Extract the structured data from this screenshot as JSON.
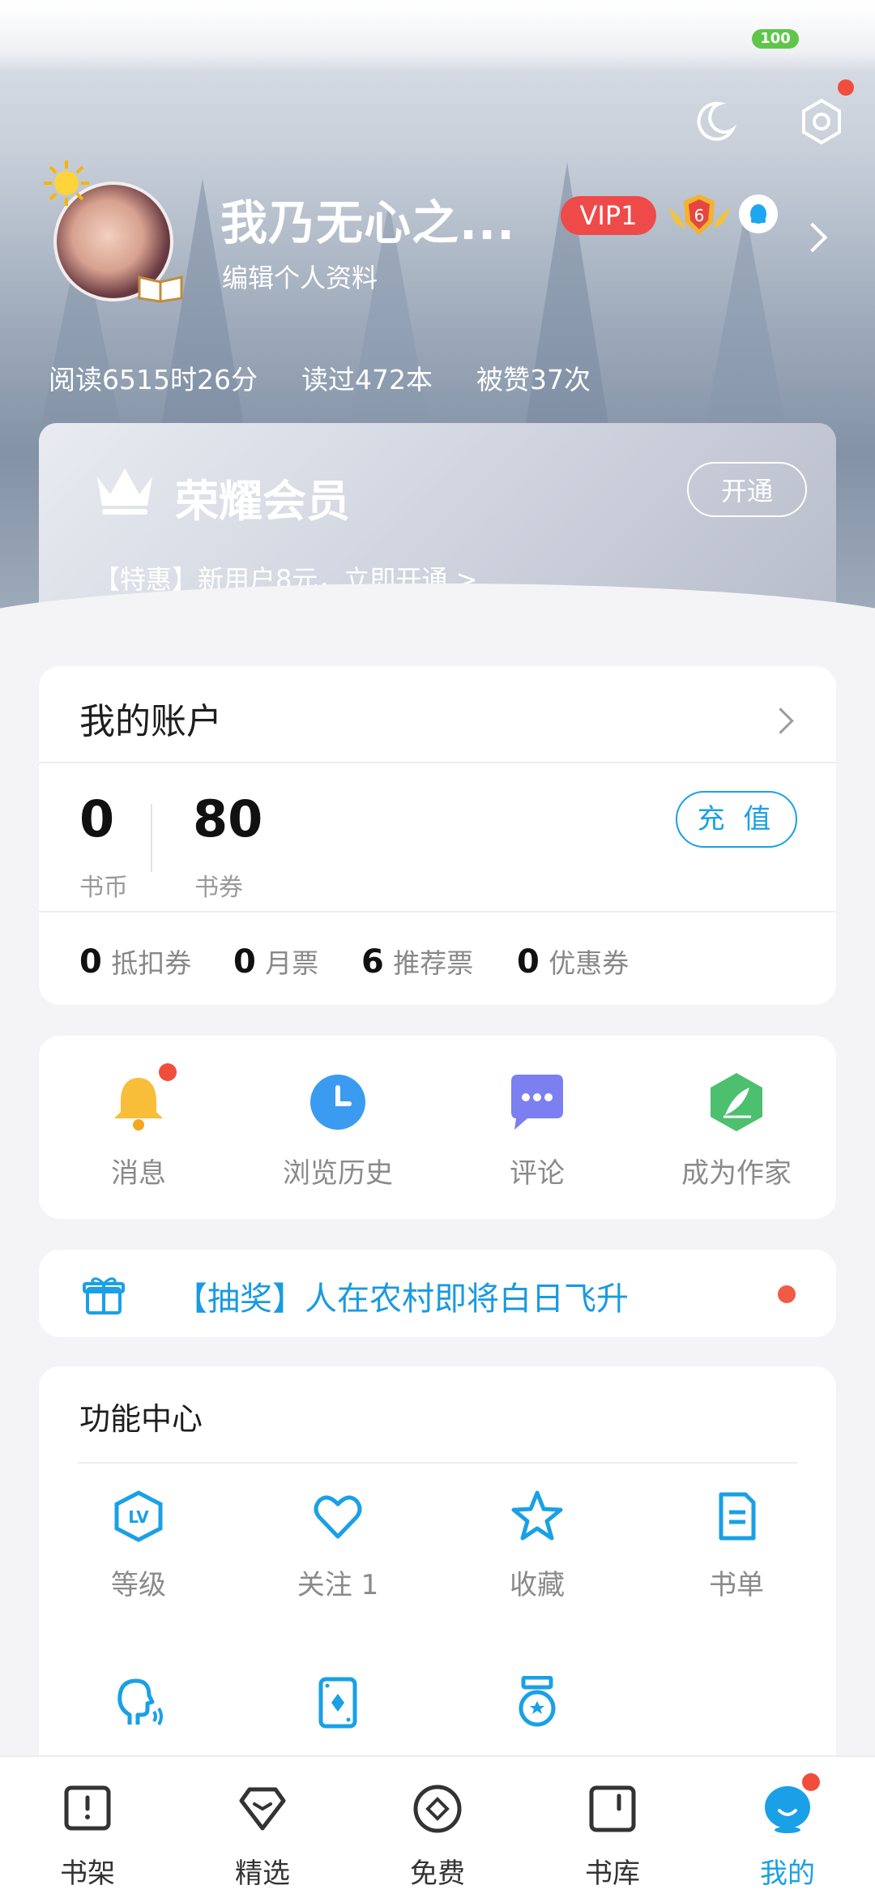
{
  "status": {
    "battery": "100"
  },
  "profile": {
    "username": "我乃无心之...",
    "edit_label": "编辑个人资料",
    "vip_label": "VIP1",
    "level": "6",
    "stats": [
      "阅读6515时26分",
      "读过472本",
      "被赞37次"
    ]
  },
  "membership": {
    "title": "荣耀会员",
    "open_label": "开通",
    "promo": "【特惠】新用户8元，立即开通 >"
  },
  "account": {
    "title": "我的账户",
    "coins_value": "0",
    "coins_label": "书币",
    "vouchers_value": "80",
    "vouchers_label": "书券",
    "recharge_label": "充 值",
    "tickets": [
      {
        "value": "0",
        "label": "抵扣券"
      },
      {
        "value": "0",
        "label": "月票"
      },
      {
        "value": "6",
        "label": "推荐票"
      },
      {
        "value": "0",
        "label": "优惠券"
      }
    ]
  },
  "quick_actions": [
    {
      "label": "消息",
      "icon": "bell-icon"
    },
    {
      "label": "浏览历史",
      "icon": "clock-icon"
    },
    {
      "label": "评论",
      "icon": "chat-bubble-icon"
    },
    {
      "label": "成为作家",
      "icon": "feather-pen-icon"
    }
  ],
  "lottery": {
    "text": "【抽奖】人在农村即将白日飞升"
  },
  "features": {
    "title": "功能中心",
    "items": [
      {
        "label": "等级",
        "icon": "level-icon"
      },
      {
        "label": "关注 1",
        "icon": "heart-icon"
      },
      {
        "label": "收藏",
        "icon": "star-icon"
      },
      {
        "label": "书单",
        "icon": "booklist-icon"
      },
      {
        "label": "",
        "icon": "voice-icon"
      },
      {
        "label": "",
        "icon": "card-icon"
      },
      {
        "label": "",
        "icon": "medal-icon"
      }
    ]
  },
  "bottom_nav": [
    {
      "label": "书架",
      "icon": "bookshelf-icon"
    },
    {
      "label": "精选",
      "icon": "gem-icon"
    },
    {
      "label": "免费",
      "icon": "free-icon"
    },
    {
      "label": "书库",
      "icon": "library-icon"
    },
    {
      "label": "我的",
      "icon": "profile-mascot-icon",
      "active": true
    }
  ],
  "colors": {
    "accent": "#1aa0e6",
    "vip_red": "#ef4a4a",
    "dot_red": "#f25a44"
  }
}
